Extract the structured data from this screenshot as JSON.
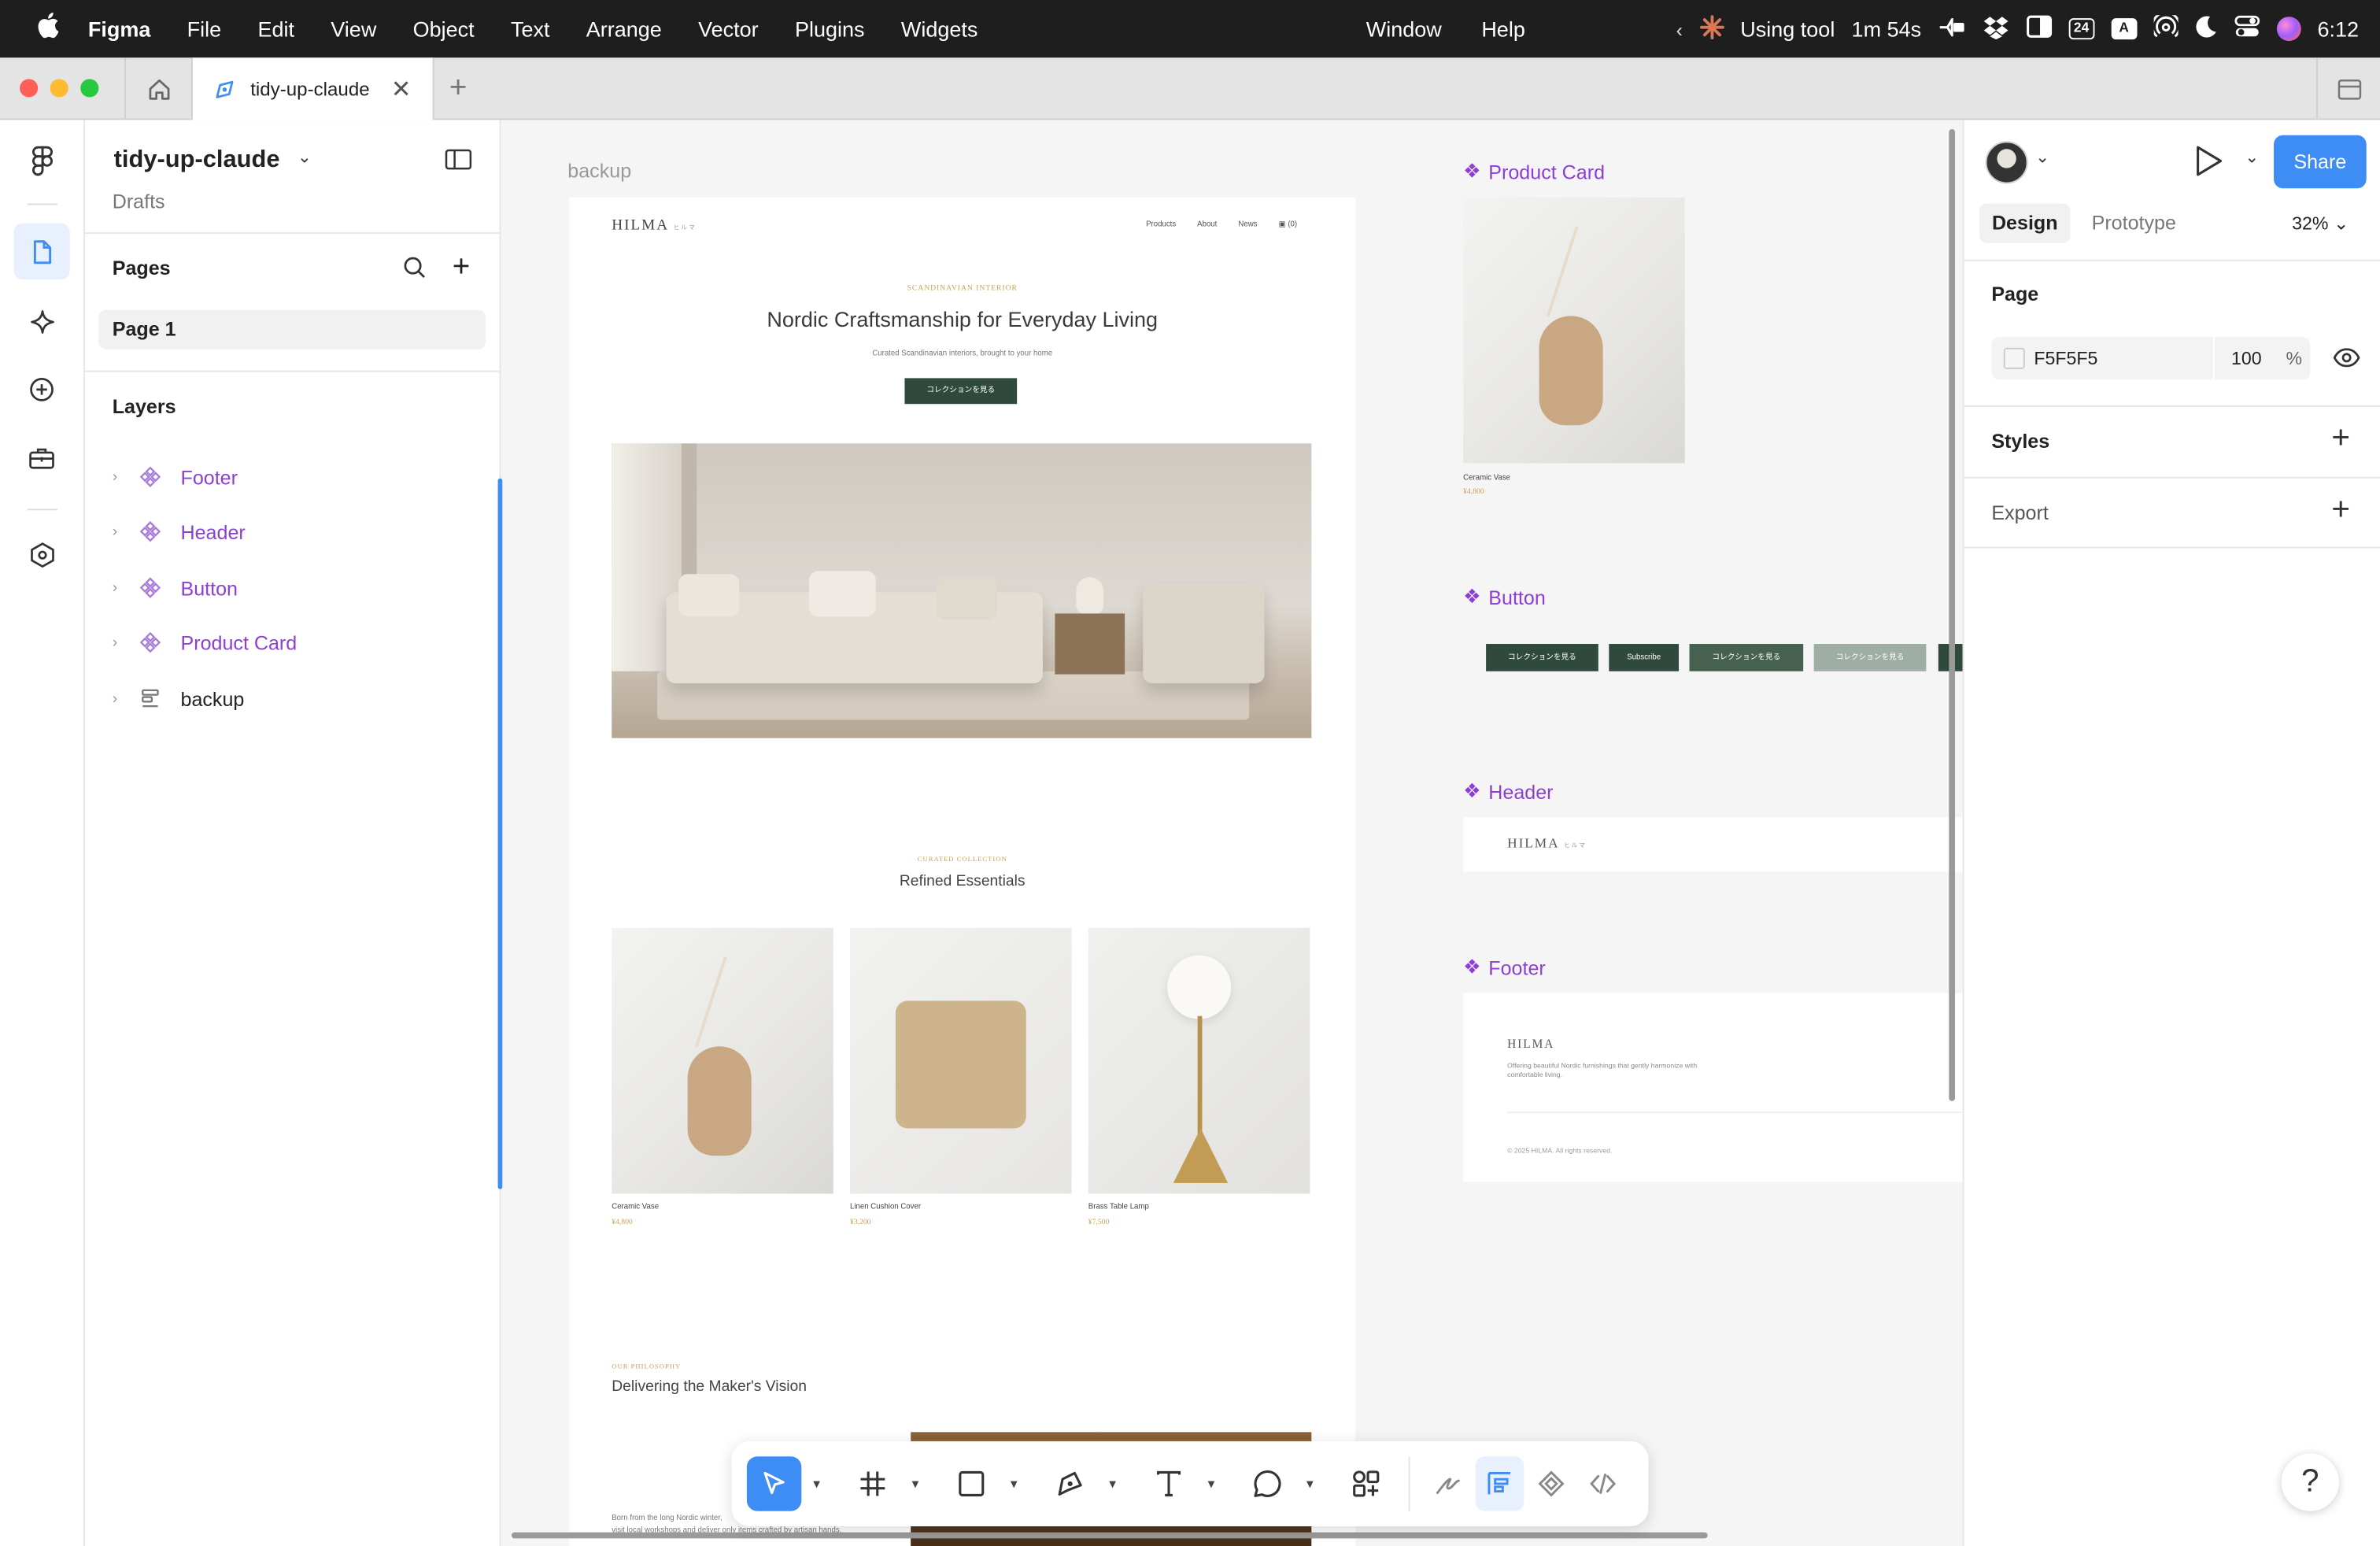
{
  "menubar": {
    "app": "Figma",
    "items": [
      "File",
      "Edit",
      "View",
      "Object",
      "Text",
      "Arrange",
      "Vector",
      "Plugins",
      "Widgets",
      "Window",
      "Help"
    ],
    "status_text": "Using tool",
    "timer": "1m 54s",
    "calendar_day": "24",
    "input_source": "A",
    "time": "6:12"
  },
  "tabbar": {
    "tab_title": "tidy-up-claude"
  },
  "leftpanel": {
    "file_name": "tidy-up-claude",
    "location": "Drafts",
    "pages_heading": "Pages",
    "pages": [
      "Page 1"
    ],
    "layers_heading": "Layers",
    "layers": [
      {
        "name": "Footer",
        "kind": "component"
      },
      {
        "name": "Header",
        "kind": "component"
      },
      {
        "name": "Button",
        "kind": "component"
      },
      {
        "name": "Product Card",
        "kind": "component"
      },
      {
        "name": "backup",
        "kind": "frame"
      }
    ]
  },
  "canvas": {
    "backup_label": "backup",
    "site": {
      "logo": "HILMA",
      "logo_sub": "ヒルマ",
      "nav": [
        "Products",
        "About",
        "News"
      ],
      "cart": "(0)",
      "eyebrow": "SCANDINAVIAN INTERIOR",
      "hero_title": "Nordic Craftsmanship for Everyday Living",
      "hero_sub": "Curated Scandinavian interiors, brought to your home",
      "cta": "コレクションを見る",
      "collection_eyebrow": "CURATED COLLECTION",
      "collection_title": "Refined Essentials",
      "products": [
        {
          "name": "Ceramic Vase",
          "price": "¥4,800"
        },
        {
          "name": "Linen Cushion Cover",
          "price": "¥3,200"
        },
        {
          "name": "Brass Table Lamp",
          "price": "¥7,500"
        }
      ],
      "story_eyebrow": "OUR PHILOSOPHY",
      "story_title": "Delivering the Maker's Vision",
      "story_text_1": "Born from the long Nordic winter,",
      "story_text_2": "visit local workshops and deliver only items crafted by artisan hands."
    },
    "components": {
      "product_card_label": "Product Card",
      "product_card_name": "Ceramic Vase",
      "product_card_price": "¥4,800",
      "button_label": "Button",
      "button_variants": [
        "コレクションを見る",
        "Subscribe",
        "コレクションを見る",
        "コレクションを見る"
      ],
      "header_label": "Header",
      "header_logo": "HILMA",
      "header_logo_sub": "ヒルマ",
      "footer_label": "Footer",
      "footer_logo": "HILMA",
      "footer_text": "Offering beautiful Nordic furnishings that gently harmonize with comfortable living.",
      "footer_copyright": "© 2025 HILMA. All rights reserved."
    }
  },
  "rightpanel": {
    "share": "Share",
    "tabs": [
      "Design",
      "Prototype"
    ],
    "zoom": "32%",
    "page_heading": "Page",
    "bg_color": "F5F5F5",
    "opacity": "100",
    "percent": "%",
    "styles": "Styles",
    "export": "Export"
  },
  "toolbar": {
    "tools": [
      "move-tool",
      "frame-tool",
      "shape-tool",
      "pen-tool",
      "text-tool",
      "comment-tool",
      "actions-tool",
      "draw-mode",
      "design-mode",
      "dev-component",
      "dev-mode"
    ]
  },
  "help": "?",
  "colors": {
    "accent": "#8C3FD4",
    "share_blue": "#3D8DF5",
    "brand_green": "#2F4A3D",
    "gold": "#C9A15A"
  }
}
